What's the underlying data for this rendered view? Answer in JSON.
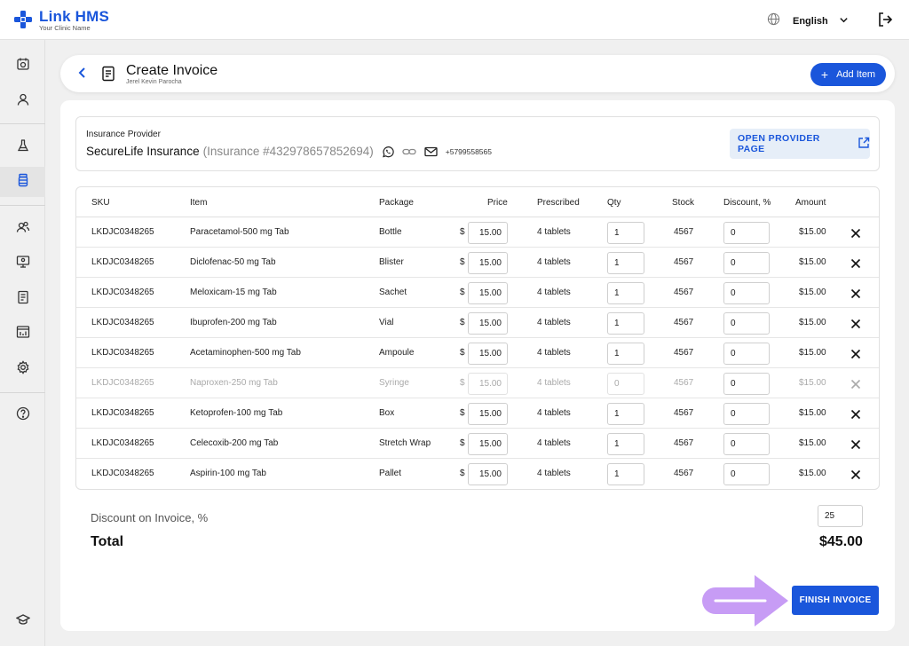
{
  "app": {
    "name": "Link HMS",
    "subtitle": "Your Clinic Name",
    "brand_color": "#1a56db"
  },
  "topbar": {
    "language": "English",
    "icons": [
      "globe-icon",
      "chevron-down-icon",
      "logout-icon"
    ]
  },
  "sidebar": {
    "items": [
      {
        "name": "calendar-icon",
        "active": false
      },
      {
        "name": "user-icon",
        "active": false
      },
      {
        "name": "flask-icon",
        "active": false
      },
      {
        "name": "pill-bottle-icon",
        "active": true
      },
      {
        "name": "group-icon",
        "active": false
      },
      {
        "name": "monitor-icon",
        "active": false
      },
      {
        "name": "document-icon",
        "active": false
      },
      {
        "name": "report-icon",
        "active": false
      },
      {
        "name": "gear-icon",
        "active": false
      },
      {
        "name": "help-icon",
        "active": false
      },
      {
        "name": "graduation-cap-icon",
        "active": false
      }
    ]
  },
  "header": {
    "title": "Create Invoice",
    "subtitle": "Jerel Kevin Parocha",
    "add_label": "Add Item"
  },
  "insurance": {
    "label": "Insurance Provider",
    "name": "SecureLife Insurance",
    "number": "(Insurance #432978657852694)",
    "phone": "+5799558565",
    "open_label": "OPEN PROVIDER PAGE"
  },
  "table": {
    "headers": {
      "sku": "SKU",
      "item": "Item",
      "package": "Package",
      "price": "Price",
      "prescribed": "Prescribed",
      "qty": "Qty",
      "stock": "Stock",
      "discount": "Discount, %",
      "amount": "Amount"
    },
    "currency": "$",
    "rows": [
      {
        "sku": "LKDJC0348265",
        "item": "Paracetamol-500 mg Tab",
        "package": "Bottle",
        "price": "15.00",
        "prescribed": "4 tablets",
        "qty": "1",
        "stock": "4567",
        "discount": "0",
        "amount": "$15.00",
        "disabled": false
      },
      {
        "sku": "LKDJC0348265",
        "item": "Diclofenac-50 mg Tab",
        "package": "Blister",
        "price": "15.00",
        "prescribed": "4 tablets",
        "qty": "1",
        "stock": "4567",
        "discount": "0",
        "amount": "$15.00",
        "disabled": false
      },
      {
        "sku": "LKDJC0348265",
        "item": "Meloxicam-15 mg Tab",
        "package": "Sachet",
        "price": "15.00",
        "prescribed": "4 tablets",
        "qty": "1",
        "stock": "4567",
        "discount": "0",
        "amount": "$15.00",
        "disabled": false
      },
      {
        "sku": "LKDJC0348265",
        "item": "Ibuprofen-200 mg Tab",
        "package": "Vial",
        "price": "15.00",
        "prescribed": "4 tablets",
        "qty": "1",
        "stock": "4567",
        "discount": "0",
        "amount": "$15.00",
        "disabled": false
      },
      {
        "sku": "LKDJC0348265",
        "item": "Acetaminophen-500 mg Tab",
        "package": "Ampoule",
        "price": "15.00",
        "prescribed": "4 tablets",
        "qty": "1",
        "stock": "4567",
        "discount": "0",
        "amount": "$15.00",
        "disabled": false
      },
      {
        "sku": "LKDJC0348265",
        "item": "Naproxen-250 mg Tab",
        "package": "Syringe",
        "price": "15.00",
        "prescribed": "4 tablets",
        "qty": "0",
        "stock": "4567",
        "discount": "0",
        "amount": "$15.00",
        "disabled": true
      },
      {
        "sku": "LKDJC0348265",
        "item": "Ketoprofen-100 mg Tab",
        "package": "Box",
        "price": "15.00",
        "prescribed": "4 tablets",
        "qty": "1",
        "stock": "4567",
        "discount": "0",
        "amount": "$15.00",
        "disabled": false
      },
      {
        "sku": "LKDJC0348265",
        "item": "Celecoxib-200 mg Tab",
        "package": "Stretch Wrap",
        "price": "15.00",
        "prescribed": "4 tablets",
        "qty": "1",
        "stock": "4567",
        "discount": "0",
        "amount": "$15.00",
        "disabled": false
      },
      {
        "sku": "LKDJC0348265",
        "item": "Aspirin-100 mg Tab",
        "package": "Pallet",
        "price": "15.00",
        "prescribed": "4 tablets",
        "qty": "1",
        "stock": "4567",
        "discount": "0",
        "amount": "$15.00",
        "disabled": false
      }
    ]
  },
  "summary": {
    "discount_label": "Discount on Invoice, %",
    "discount_value": "25",
    "total_label": "Total",
    "total_value": "$45.00"
  },
  "finish": {
    "label": "FINISH INVOICE",
    "arrow_color": "#c79cf5"
  }
}
